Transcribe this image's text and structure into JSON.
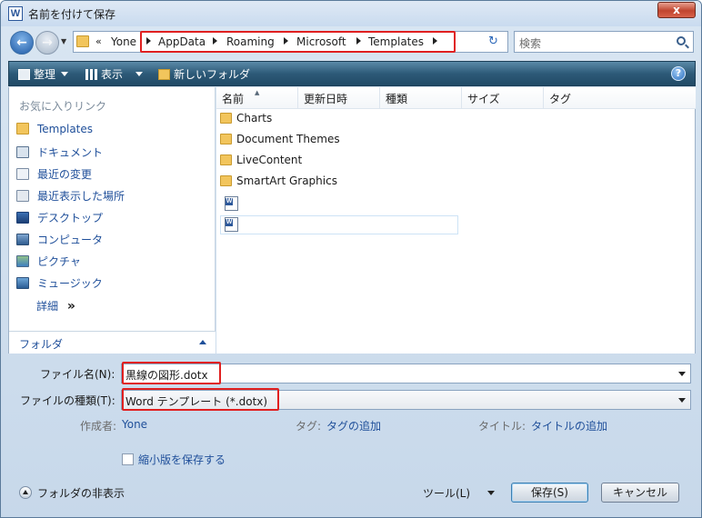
{
  "window": {
    "title": "名前を付けて保存",
    "app_icon_letter": "W",
    "close_symbol": "x"
  },
  "address": {
    "overflow_chevron": "«",
    "crumbs": [
      "Yone",
      "AppData",
      "Roaming",
      "Microsoft",
      "Templates"
    ]
  },
  "search": {
    "placeholder": "検索"
  },
  "toolbar": {
    "organize": "整理",
    "views": "表示",
    "new_folder": "新しいフォルダ",
    "help_symbol": "?"
  },
  "sidebar": {
    "header": "お気に入りリンク",
    "items": [
      {
        "label": "Templates",
        "icon": "folder-icon"
      },
      {
        "label": "ドキュメント",
        "icon": "documents-icon"
      },
      {
        "label": "最近の変更",
        "icon": "recent-changes-icon"
      },
      {
        "label": "最近表示した場所",
        "icon": "recent-places-icon"
      },
      {
        "label": "デスクトップ",
        "icon": "desktop-icon"
      },
      {
        "label": "コンピュータ",
        "icon": "computer-icon"
      },
      {
        "label": "ピクチャ",
        "icon": "pictures-icon"
      },
      {
        "label": "ミュージック",
        "icon": "music-icon"
      }
    ],
    "more": "詳細",
    "more_glyph": "»",
    "folders_header": "フォルダ"
  },
  "file_list": {
    "columns": [
      "名前",
      "更新日時",
      "種類",
      "サイズ",
      "タグ"
    ],
    "folders": [
      "Charts",
      "Document Themes",
      "LiveContent",
      "SmartArt Graphics"
    ],
    "documents": [
      "",
      ""
    ]
  },
  "form": {
    "filename_label": "ファイル名(N):",
    "filename_value": "黒線の図形.dotx",
    "filetype_label": "ファイルの種類(T):",
    "filetype_value": "Word テンプレート (*.dotx)",
    "author_label": "作成者:",
    "author_value": "Yone",
    "tags_label": "タグ:",
    "tags_value": "タグの追加",
    "title_label": "タイトル:",
    "title_value": "タイトルの追加",
    "thumbnail_label": "縮小版を保存する",
    "thumbnail_checked": false
  },
  "footer": {
    "hide_folders": "フォルダの非表示",
    "tools": "ツール(L)",
    "save": "保存(S)",
    "cancel": "キャンセル"
  },
  "colors": {
    "highlight_box": "#e02020",
    "link_blue": "#1f4f9a",
    "toolbar": "#2d5a78"
  }
}
